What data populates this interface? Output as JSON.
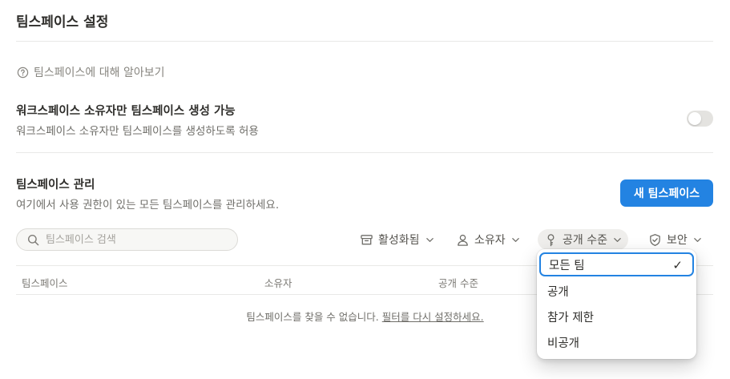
{
  "page": {
    "title": "팀스페이스 설정"
  },
  "learn_link": {
    "label": "팀스페이스에 대해 알아보기"
  },
  "owner_only_setting": {
    "title": "워크스페이스 소유자만 팀스페이스 생성 가능",
    "description": "워크스페이스 소유자만 팀스페이스를 생성하도록 허용",
    "enabled": false
  },
  "manage": {
    "title": "팀스페이스 관리",
    "description": "여기에서 사용 권한이 있는 모든 팀스페이스를 관리하세요.",
    "new_button": "새 팀스페이스"
  },
  "search": {
    "placeholder": "팀스페이스 검색",
    "value": ""
  },
  "filters": {
    "active": "활성화됨",
    "owner": "소유자",
    "access_level": "공개 수준",
    "security": "보안"
  },
  "table": {
    "columns": [
      "팀스페이스",
      "소유자",
      "공개 수준"
    ],
    "empty_message": "팀스페이스를 찾을 수 없습니다.",
    "reset_link": "필터를 다시 설정하세요."
  },
  "dropdown": {
    "options": [
      "모든 팀",
      "공개",
      "참가 제한",
      "비공개"
    ],
    "selected": "모든 팀",
    "check_mark": "✓"
  }
}
